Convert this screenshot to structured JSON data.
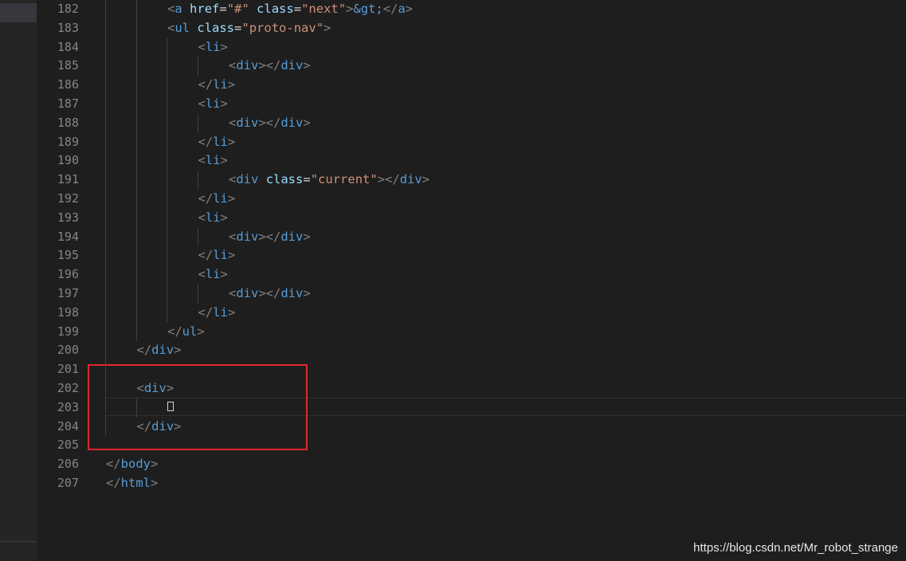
{
  "editor": {
    "line_numbers": [
      "182",
      "183",
      "184",
      "185",
      "186",
      "187",
      "188",
      "189",
      "190",
      "191",
      "192",
      "193",
      "194",
      "195",
      "196",
      "197",
      "198",
      "199",
      "200",
      "201",
      "202",
      "203",
      "204",
      "205",
      "206",
      "207"
    ],
    "lines": [
      {
        "indent": 2,
        "tokens": [
          [
            "br",
            "<"
          ],
          [
            "tag",
            "a"
          ],
          [
            "txt",
            " "
          ],
          [
            "attr",
            "href"
          ],
          [
            "txt",
            "="
          ],
          [
            "str",
            "\"#\""
          ],
          [
            "txt",
            " "
          ],
          [
            "attr",
            "class"
          ],
          [
            "txt",
            "="
          ],
          [
            "str",
            "\"next\""
          ],
          [
            "br",
            ">"
          ],
          [
            "tag",
            "&gt;"
          ],
          [
            "br",
            "</"
          ],
          [
            "tag",
            "a"
          ],
          [
            "br",
            ">"
          ]
        ]
      },
      {
        "indent": 2,
        "tokens": [
          [
            "br",
            "<"
          ],
          [
            "tag",
            "ul"
          ],
          [
            "txt",
            " "
          ],
          [
            "attr",
            "class"
          ],
          [
            "txt",
            "="
          ],
          [
            "str",
            "\"proto-nav\""
          ],
          [
            "br",
            ">"
          ]
        ]
      },
      {
        "indent": 3,
        "tokens": [
          [
            "br",
            "<"
          ],
          [
            "tag",
            "li"
          ],
          [
            "br",
            ">"
          ]
        ]
      },
      {
        "indent": 4,
        "tokens": [
          [
            "br",
            "<"
          ],
          [
            "tag",
            "div"
          ],
          [
            "br",
            "></"
          ],
          [
            "tag",
            "div"
          ],
          [
            "br",
            ">"
          ]
        ]
      },
      {
        "indent": 3,
        "tokens": [
          [
            "br",
            "</"
          ],
          [
            "tag",
            "li"
          ],
          [
            "br",
            ">"
          ]
        ]
      },
      {
        "indent": 3,
        "tokens": [
          [
            "br",
            "<"
          ],
          [
            "tag",
            "li"
          ],
          [
            "br",
            ">"
          ]
        ]
      },
      {
        "indent": 4,
        "tokens": [
          [
            "br",
            "<"
          ],
          [
            "tag",
            "div"
          ],
          [
            "br",
            "></"
          ],
          [
            "tag",
            "div"
          ],
          [
            "br",
            ">"
          ]
        ]
      },
      {
        "indent": 3,
        "tokens": [
          [
            "br",
            "</"
          ],
          [
            "tag",
            "li"
          ],
          [
            "br",
            ">"
          ]
        ]
      },
      {
        "indent": 3,
        "tokens": [
          [
            "br",
            "<"
          ],
          [
            "tag",
            "li"
          ],
          [
            "br",
            ">"
          ]
        ]
      },
      {
        "indent": 4,
        "tokens": [
          [
            "br",
            "<"
          ],
          [
            "tag",
            "div"
          ],
          [
            "txt",
            " "
          ],
          [
            "attr",
            "class"
          ],
          [
            "txt",
            "="
          ],
          [
            "str",
            "\"current\""
          ],
          [
            "br",
            "></"
          ],
          [
            "tag",
            "div"
          ],
          [
            "br",
            ">"
          ]
        ]
      },
      {
        "indent": 3,
        "tokens": [
          [
            "br",
            "</"
          ],
          [
            "tag",
            "li"
          ],
          [
            "br",
            ">"
          ]
        ]
      },
      {
        "indent": 3,
        "tokens": [
          [
            "br",
            "<"
          ],
          [
            "tag",
            "li"
          ],
          [
            "br",
            ">"
          ]
        ]
      },
      {
        "indent": 4,
        "tokens": [
          [
            "br",
            "<"
          ],
          [
            "tag",
            "div"
          ],
          [
            "br",
            "></"
          ],
          [
            "tag",
            "div"
          ],
          [
            "br",
            ">"
          ]
        ]
      },
      {
        "indent": 3,
        "tokens": [
          [
            "br",
            "</"
          ],
          [
            "tag",
            "li"
          ],
          [
            "br",
            ">"
          ]
        ]
      },
      {
        "indent": 3,
        "tokens": [
          [
            "br",
            "<"
          ],
          [
            "tag",
            "li"
          ],
          [
            "br",
            ">"
          ]
        ]
      },
      {
        "indent": 4,
        "tokens": [
          [
            "br",
            "<"
          ],
          [
            "tag",
            "div"
          ],
          [
            "br",
            "></"
          ],
          [
            "tag",
            "div"
          ],
          [
            "br",
            ">"
          ]
        ]
      },
      {
        "indent": 3,
        "tokens": [
          [
            "br",
            "</"
          ],
          [
            "tag",
            "li"
          ],
          [
            "br",
            ">"
          ]
        ]
      },
      {
        "indent": 2,
        "tokens": [
          [
            "br",
            "</"
          ],
          [
            "tag",
            "ul"
          ],
          [
            "br",
            ">"
          ]
        ]
      },
      {
        "indent": 1,
        "tokens": [
          [
            "br",
            "</"
          ],
          [
            "tag",
            "div"
          ],
          [
            "br",
            ">"
          ]
        ]
      },
      {
        "indent": 0,
        "tokens": []
      },
      {
        "indent": 1,
        "tokens": [
          [
            "br",
            "<"
          ],
          [
            "tag",
            "div"
          ],
          [
            "br",
            ">"
          ]
        ]
      },
      {
        "indent": 2,
        "tokens": []
      },
      {
        "indent": 1,
        "tokens": [
          [
            "br",
            "</"
          ],
          [
            "tag",
            "div"
          ],
          [
            "br",
            ">"
          ]
        ]
      },
      {
        "indent": 0,
        "tokens": []
      },
      {
        "indent": 0,
        "tokens": [
          [
            "br",
            "</"
          ],
          [
            "tag",
            "body"
          ],
          [
            "br",
            ">"
          ]
        ]
      },
      {
        "indent": 0,
        "tokens": [
          [
            "br",
            "</"
          ],
          [
            "tag",
            "html"
          ],
          [
            "br",
            ">"
          ]
        ]
      }
    ],
    "cursor_line": "203"
  },
  "watermark": "https://blog.csdn.net/Mr_robot_strange",
  "colors": {
    "background": "#1e1e1e",
    "line_number": "#858585",
    "tag": "#569cd6",
    "bracket": "#808080",
    "attribute": "#9cdcfe",
    "string": "#ce9178",
    "highlight_box": "#e0282f"
  }
}
